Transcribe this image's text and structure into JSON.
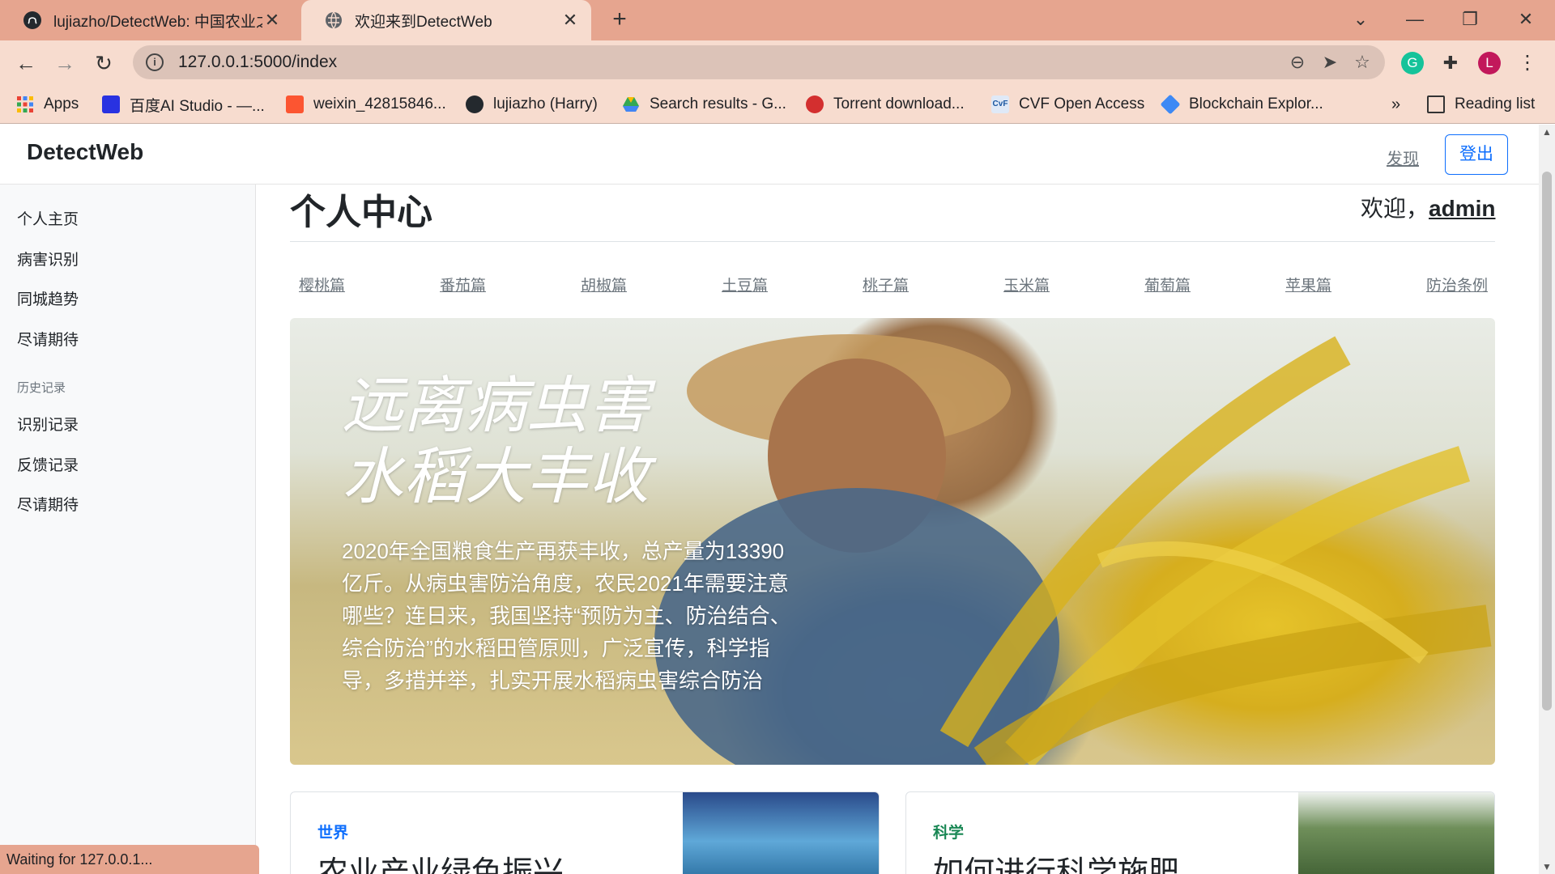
{
  "browser": {
    "tabs": [
      {
        "title": "lujiazho/DetectWeb: 中国农业之",
        "icon": "github-icon"
      },
      {
        "title": "欢迎来到DetectWeb",
        "icon": "globe-icon"
      }
    ],
    "url": "127.0.0.1:5000/index",
    "bookmarks": [
      {
        "label": "Apps",
        "icon": "apps-grid-icon"
      },
      {
        "label": "百度AI Studio - —...",
        "icon": "baidu-icon"
      },
      {
        "label": "weixin_42815846...",
        "icon": "csdn-icon"
      },
      {
        "label": "lujiazho (Harry)",
        "icon": "github-icon"
      },
      {
        "label": "Search results - G...",
        "icon": "google-drive-icon"
      },
      {
        "label": "Torrent download...",
        "icon": "torrent-icon"
      },
      {
        "label": "CVF Open Access",
        "icon": "cvf-icon"
      },
      {
        "label": "Blockchain Explor...",
        "icon": "blockchain-icon"
      }
    ],
    "bookmarks_overflow": "»",
    "reading_list": "Reading list",
    "profile_initial": "L",
    "status": "Waiting for 127.0.0.1..."
  },
  "navbar": {
    "brand": "DetectWeb",
    "discover": "发现",
    "logout": "登出"
  },
  "sidebar": {
    "items": [
      "个人主页",
      "病害识别",
      "同城趋势",
      "尽请期待"
    ],
    "history_heading": "历史记录",
    "history_items": [
      "识别记录",
      "反馈记录",
      "尽请期待"
    ]
  },
  "main": {
    "title": "个人中心",
    "welcome": "欢迎，",
    "username": "admin",
    "categories": [
      "樱桃篇",
      "番茄篇",
      "胡椒篇",
      "土豆篇",
      "桃子篇",
      "玉米篇",
      "葡萄篇",
      "苹果篇",
      "防治条例"
    ],
    "hero": {
      "title_line1": "远离病虫害",
      "title_line2": "水稻大丰收",
      "text": "2020年全国粮食生产再获丰收，总产量为13390亿斤。从病虫害防治角度，农民2021年需要注意哪些？连日来，我国坚持“预防为主、防治结合、综合防治”的水稻田管原则，广泛宣传，科学指导，多措并举，扎实开展水稻病虫害综合防治"
    },
    "cards": [
      {
        "category": "世界",
        "category_color": "#0d6efd",
        "headline": "农业产业绿色振兴"
      },
      {
        "category": "科学",
        "category_color": "#198754",
        "headline": "如何进行科学施肥"
      }
    ]
  },
  "colors": {
    "tabstrip": "#e6a58f",
    "toolbar": "#f7dccf",
    "primary": "#0d6efd",
    "success": "#198754"
  }
}
